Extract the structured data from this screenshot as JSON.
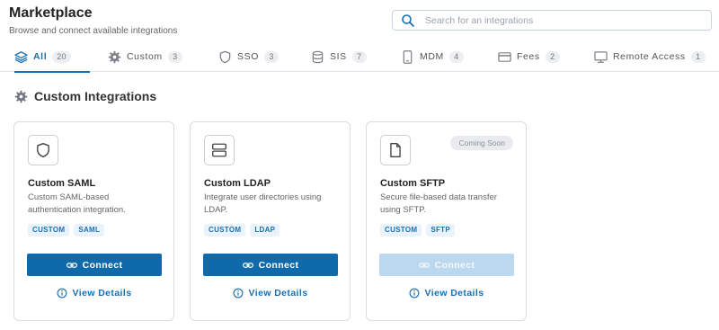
{
  "header": {
    "title": "Marketplace",
    "subtitle": "Browse and connect available integrations",
    "search_placeholder": "Search for an integrations",
    "search_value": ""
  },
  "tabs": [
    {
      "label": "All",
      "count": "20",
      "icon": "layers-icon",
      "active": true
    },
    {
      "label": "Custom",
      "count": "3",
      "icon": "gear-icon",
      "active": false
    },
    {
      "label": "SSO",
      "count": "3",
      "icon": "shield-icon",
      "active": false
    },
    {
      "label": "SIS",
      "count": "7",
      "icon": "database-icon",
      "active": false
    },
    {
      "label": "MDM",
      "count": "4",
      "icon": "mobile-icon",
      "active": false
    },
    {
      "label": "Fees",
      "count": "2",
      "icon": "credit-card-icon",
      "active": false
    },
    {
      "label": "Remote Access",
      "count": "1",
      "icon": "monitor-icon",
      "active": false
    }
  ],
  "section": {
    "title": "Custom Integrations",
    "icon": "gear-icon"
  },
  "cards": [
    {
      "name": "Custom SAML",
      "description": "Custom SAML-based authentication integration.",
      "icon": "shield-icon",
      "tags": [
        "CUSTOM",
        "SAML"
      ],
      "connect_label": "Connect",
      "connect_enabled": true,
      "details_label": "View Details",
      "status_badge": ""
    },
    {
      "name": "Custom LDAP",
      "description": "Integrate user directories using LDAP.",
      "icon": "server-icon",
      "tags": [
        "CUSTOM",
        "LDAP"
      ],
      "connect_label": "Connect",
      "connect_enabled": true,
      "details_label": "View Details",
      "status_badge": ""
    },
    {
      "name": "Custom SFTP",
      "description": "Secure file-based data transfer using SFTP.",
      "icon": "file-icon",
      "tags": [
        "CUSTOM",
        "SFTP"
      ],
      "connect_label": "Connect",
      "connect_enabled": false,
      "details_label": "View Details",
      "status_badge": "Coming Soon"
    }
  ],
  "colors": {
    "accent": "#1a6fb0",
    "button": "#0f6aac",
    "button_disabled": "#bcd8ee",
    "tag_bg": "#eaf3fb"
  }
}
